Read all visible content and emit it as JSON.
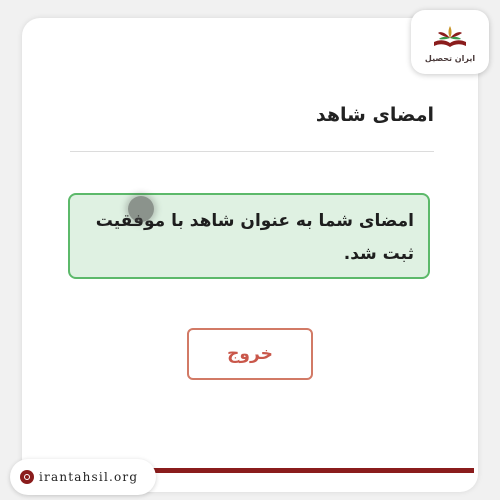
{
  "logo": {
    "text": "ایران تحصیل",
    "icon": "book-leaves-logo"
  },
  "page_title": "امضای شاهد",
  "success_message": "امضای شما به عنوان شاهد با موفقیت ثبت شد.",
  "exit_button_label": "خروج",
  "footer": {
    "url": "irantahsil.org",
    "icon": "at-icon"
  },
  "colors": {
    "success_bg": "#dff1e2",
    "success_border": "#5cb96a",
    "exit_border": "#d27a66",
    "exit_text": "#c9574a",
    "brand": "#8a1c1c"
  }
}
